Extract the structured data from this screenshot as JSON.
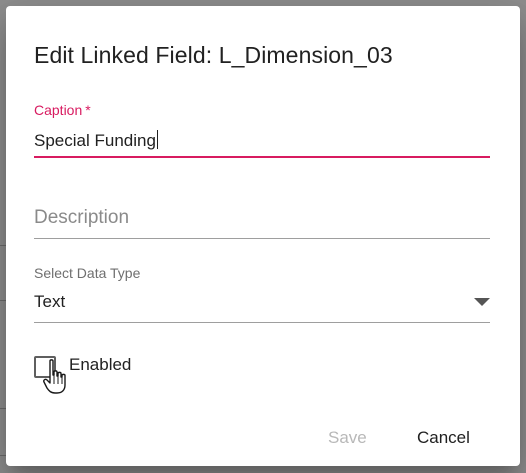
{
  "dialog": {
    "title": "Edit Linked Field: L_Dimension_03",
    "caption": {
      "label": "Caption",
      "required_mark": "*",
      "value": "Special Funding"
    },
    "description": {
      "placeholder": "Description",
      "value": ""
    },
    "data_type": {
      "label": "Select Data Type",
      "value": "Text"
    },
    "enabled": {
      "label": "Enabled",
      "checked": false
    },
    "buttons": {
      "save_label": "Save",
      "cancel_label": "Cancel"
    }
  },
  "colors": {
    "accent": "#d81b60",
    "disabled_text": "#b8b8b8",
    "backdrop": "#8f8f8f"
  }
}
